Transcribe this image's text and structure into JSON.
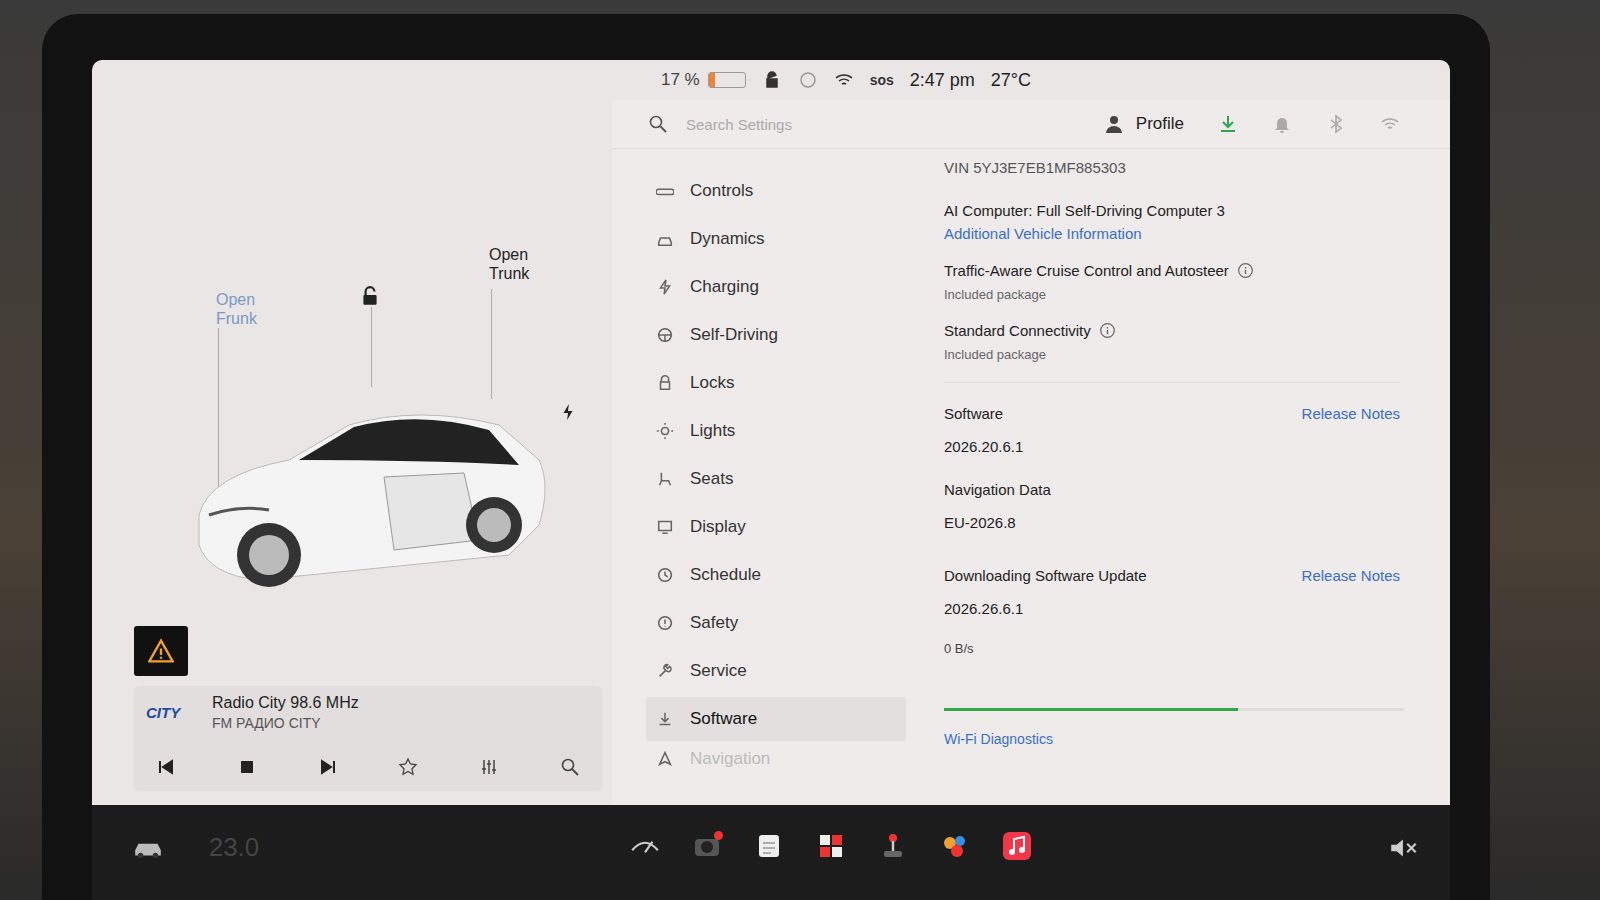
{
  "status_bar": {
    "battery": "17 %",
    "battery_level": 0.17,
    "sos": "sos",
    "time": "2:47 pm",
    "temperature": "27°C"
  },
  "car_panel": {
    "frunk": "Open Frunk",
    "trunk": "Open Trunk",
    "locked": false,
    "charging": true,
    "warning": true
  },
  "media": {
    "logo": "CITY",
    "station": "Radio City 98.6 MHz",
    "subtitle": "FM РАДИО CITY",
    "playing": true
  },
  "settings_header": {
    "search_placeholder": "Search Settings",
    "profile": "Profile",
    "download_active": true
  },
  "menu": [
    {
      "label": "Controls",
      "selected": false
    },
    {
      "label": "Dynamics",
      "selected": false
    },
    {
      "label": "Charging",
      "selected": false
    },
    {
      "label": "Self-Driving",
      "selected": false
    },
    {
      "label": "Locks",
      "selected": false
    },
    {
      "label": "Lights",
      "selected": false
    },
    {
      "label": "Seats",
      "selected": false
    },
    {
      "label": "Display",
      "selected": false
    },
    {
      "label": "Schedule",
      "selected": false
    },
    {
      "label": "Safety",
      "selected": false
    },
    {
      "label": "Service",
      "selected": false
    },
    {
      "label": "Software",
      "selected": true
    },
    {
      "label": "Navigation",
      "selected": false
    }
  ],
  "details": {
    "vin": "VIN 5YJ3E7EB1MF885303",
    "computer": "AI Computer: Full Self-Driving Computer 3",
    "more_info": "Additional Vehicle Information",
    "packages": [
      {
        "name": "Traffic-Aware Cruise Control and Autosteer",
        "note": "Included package"
      },
      {
        "name": "Standard Connectivity",
        "note": "Included package"
      }
    ],
    "software": {
      "label": "Software",
      "version": "2026.20.6.1",
      "link": "Release Notes"
    },
    "navigation": {
      "label": "Navigation Data",
      "version": "EU-2026.8"
    },
    "update": {
      "label": "Downloading Software Update",
      "version": "2026.26.6.1",
      "link": "Release Notes",
      "speed": "0 B/s",
      "level": 0.64
    },
    "wifi_link": "Wi-Fi Diagnostics"
  },
  "taskbar": {
    "cabin_temp": "23.0",
    "volume_muted": true,
    "camera_badge": true
  }
}
